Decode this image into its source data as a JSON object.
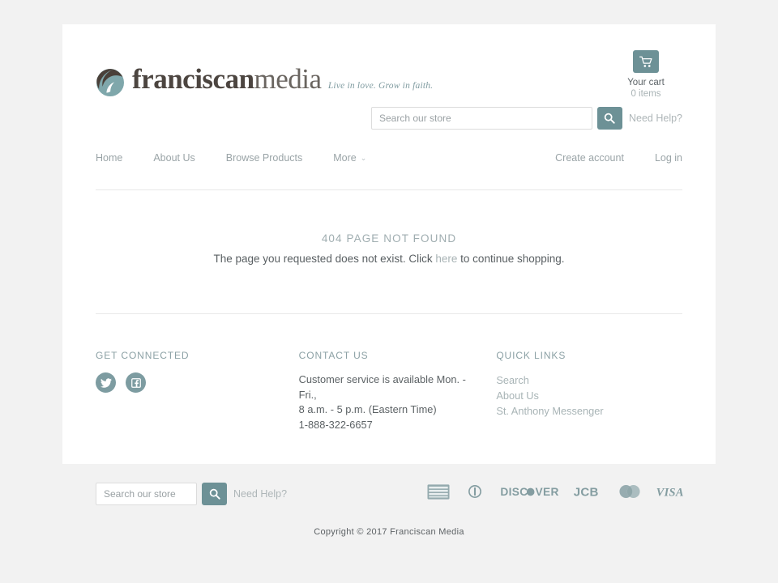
{
  "theme": {
    "accent": "#6d9196",
    "accent_soft": "#7d9ca1",
    "muted_teal": "#8ca1a5",
    "page_bg": "#f2f2f2",
    "card_bg": "#ffffff",
    "text": "#5c6265",
    "link_muted": "#a8b4b6"
  },
  "header": {
    "logo": {
      "mark": "franciscan-circle-logo",
      "word_bold": "franciscan",
      "word_light": "media",
      "tagline": "Live in love. Grow in faith."
    },
    "cart": {
      "icon": "shopping-cart-icon",
      "label": "Your cart",
      "count": "0 items"
    },
    "search": {
      "placeholder": "Search our store",
      "value": "",
      "icon": "search-icon",
      "help_label": "Need Help?"
    }
  },
  "nav": {
    "left": [
      {
        "label": "Home",
        "has_chevron": false
      },
      {
        "label": "About Us",
        "has_chevron": false
      },
      {
        "label": "Browse Products",
        "has_chevron": false
      },
      {
        "label": "More",
        "has_chevron": true
      }
    ],
    "right": [
      {
        "label": "Create account"
      },
      {
        "label": "Log in"
      }
    ],
    "chevron_glyph": "⌄"
  },
  "content": {
    "error_title": "404 PAGE NOT FOUND",
    "error_text_before": "The page you requested does not exist. Click ",
    "error_link": "here",
    "error_text_after": " to continue shopping."
  },
  "footer": {
    "connect": {
      "title": "GET CONNECTED",
      "social": [
        {
          "name": "twitter-icon",
          "label": "Twitter"
        },
        {
          "name": "facebook-icon",
          "label": "Facebook"
        }
      ]
    },
    "contact": {
      "title": "CONTACT US",
      "lines": [
        "Customer service is available Mon. -",
        "Fri.,",
        "8 a.m. - 5 p.m. (Eastern Time)",
        "1-888-322-6657"
      ]
    },
    "quick_links": {
      "title": "QUICK LINKS",
      "items": [
        {
          "label": "Search"
        },
        {
          "label": "About Us"
        },
        {
          "label": "St. Anthony Messenger"
        }
      ]
    }
  },
  "bottom": {
    "search": {
      "placeholder": "Search our store",
      "value": "",
      "icon": "search-icon",
      "help_label": "Need Help?"
    },
    "payments": [
      {
        "name": "american-express-icon",
        "label": "AMERICAN EXPRESS"
      },
      {
        "name": "diners-club-icon",
        "label": "Diners Club"
      },
      {
        "name": "discover-icon",
        "label": "DISCOVER"
      },
      {
        "name": "jcb-icon",
        "label": "JCB"
      },
      {
        "name": "mastercard-icon",
        "label": "MasterCard"
      },
      {
        "name": "visa-icon",
        "label": "VISA"
      }
    ],
    "copyright": "Copyright © 2017 Franciscan Media"
  }
}
